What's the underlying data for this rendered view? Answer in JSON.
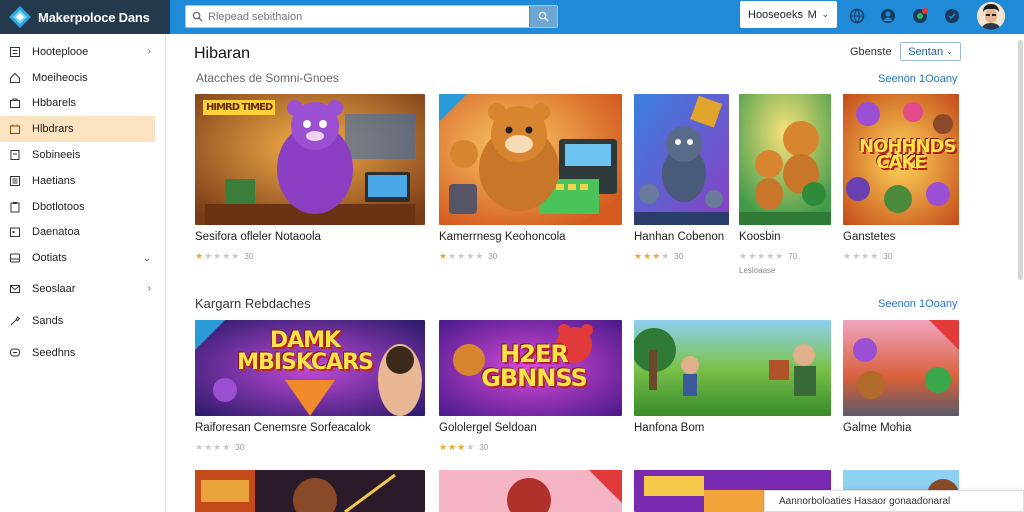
{
  "app": {
    "brand_name": "Makerpoloce Dans",
    "search_placeholder": "Rlepead sebithaion",
    "account_select": "Hooseoeks",
    "account_chevron": "M"
  },
  "sidebar": {
    "items": [
      {
        "label": "Hooteplooe",
        "icon": "list-icon",
        "chevron": "›",
        "active": false
      },
      {
        "label": "Moeiheocis",
        "icon": "home-icon",
        "chevron": "",
        "active": false
      },
      {
        "label": "Hbbarels",
        "icon": "bag-icon",
        "chevron": "",
        "active": false
      },
      {
        "label": "Hlbdrars",
        "icon": "folder-icon",
        "chevron": "",
        "active": true
      },
      {
        "label": "Sobineeis",
        "icon": "document-icon",
        "chevron": "",
        "active": false
      },
      {
        "label": "Haetians",
        "icon": "list-icon",
        "chevron": "",
        "active": false
      },
      {
        "label": "Dbotlotoos",
        "icon": "clipboard-icon",
        "chevron": "",
        "active": false
      },
      {
        "label": "Daenatoa",
        "icon": "calendar-icon",
        "chevron": "",
        "active": false
      },
      {
        "label": "Ootiats",
        "icon": "tray-icon",
        "chevron": "⌄",
        "active": false
      },
      {
        "label": "Seoslaar",
        "icon": "mail-icon",
        "chevron": "›",
        "active": false
      },
      {
        "label": "Sands",
        "icon": "tool-icon",
        "chevron": "",
        "active": false
      },
      {
        "label": "Seedhns",
        "icon": "chat-icon",
        "chevron": "",
        "active": false
      }
    ]
  },
  "main": {
    "page_title": "Hibaran",
    "sort_label": "Gbenste",
    "sort_value": "Sentan",
    "sections": [
      {
        "title": "Atacches de Somni-Gnoes",
        "see_all": "Seenon 1Ooany",
        "cards": [
          {
            "title": "Sesifora ofleler Notaoola",
            "stars": 1,
            "count": "30",
            "sub": "",
            "thumb_text": "HIMRD TIMED"
          },
          {
            "title": "Kamerrnesg Keohoncola",
            "stars": 1,
            "count": "30",
            "sub": "",
            "thumb_text": ""
          },
          {
            "title": "Hanhan Cobenon",
            "stars": 3,
            "count": "30",
            "sub": "",
            "thumb_text": ""
          },
          {
            "title": "Koosbin",
            "stars": 1,
            "count": "70",
            "sub": "Lesloaase",
            "thumb_text": ""
          },
          {
            "title": "Ganstetes",
            "stars": 1,
            "count": "30",
            "sub": "",
            "thumb_text": "NOHHNDS CAKE"
          }
        ]
      },
      {
        "title": "Kargarn Rebdaches",
        "see_all": "Seenon 1Ooany",
        "cards": [
          {
            "title": "Raiforesan Cenemsre Sorfeacalok",
            "stars": 1,
            "count": "30",
            "sub": "",
            "thumb_text": "DAMK MBISKCARS"
          },
          {
            "title": "Gololergel Seldoan",
            "stars": 3,
            "count": "30",
            "sub": "",
            "thumb_text": "H2ER GBNNSS"
          },
          {
            "title": "Hanfona Bom",
            "stars": 0,
            "count": "",
            "sub": "",
            "thumb_text": ""
          },
          {
            "title": "Galme Mohia",
            "stars": 0,
            "count": "",
            "sub": "",
            "thumb_text": ""
          }
        ]
      }
    ]
  },
  "toast": {
    "text": "Aannorboloaties Hasaor gonaadonaral"
  },
  "colors": {
    "topbar": "#1e8ad8",
    "brand_bg": "#243a4c",
    "active_item": "#fbe3bf",
    "link": "#2576c0",
    "star": "#f0a52a"
  }
}
